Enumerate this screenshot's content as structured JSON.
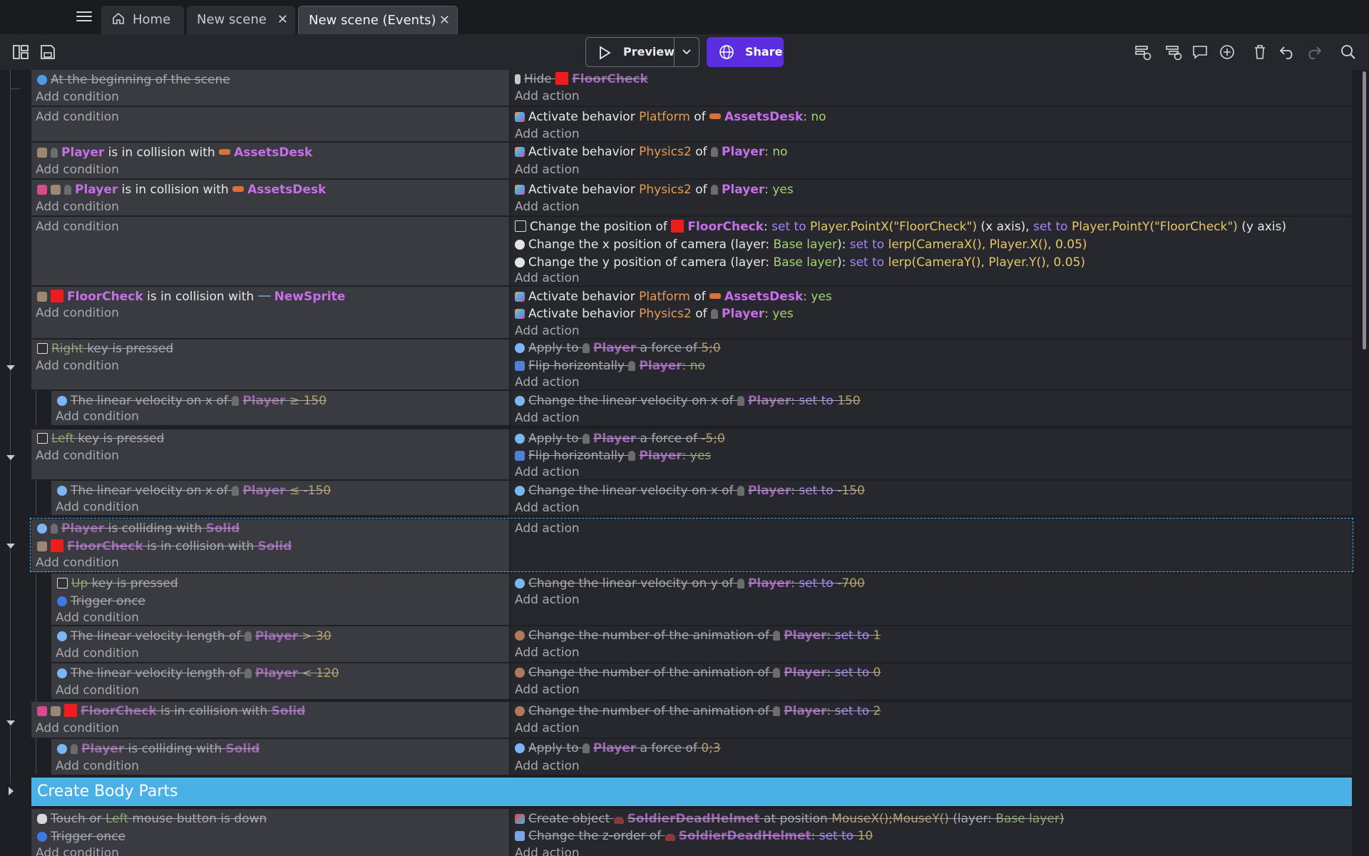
{
  "tabs": [
    {
      "label": "Home"
    },
    {
      "label": "New scene"
    },
    {
      "label": "New scene (Events)"
    }
  ],
  "toolbar": {
    "preview_label": "Preview",
    "share_label": "Share"
  },
  "common": {
    "add_condition": "Add condition",
    "add_action": "Add action",
    "of": "of",
    "colon_no": ": no",
    "colon_yes": ": yes",
    "set_to": "set to"
  },
  "events": {
    "e1": {
      "cond": "At the beginning of the scene",
      "act_hide": "Hide",
      "obj": "FloorCheck"
    },
    "e2": {
      "act_pre": "Activate behavior",
      "beh": "Platform",
      "obj": "AssetsDesk",
      "val": ": no"
    },
    "e3": {
      "obj1": "Player",
      "mid": "is in collision with",
      "obj2": "AssetsDesk",
      "act_pre": "Activate behavior",
      "beh": "Physics2",
      "aobj": "Player",
      "val": ": no"
    },
    "e4": {
      "obj1": "Player",
      "mid": "is in collision with",
      "obj2": "AssetsDesk",
      "act_pre": "Activate behavior",
      "beh": "Physics2",
      "aobj": "Player",
      "val": ": yes"
    },
    "e5": {
      "a1_pre": "Change the position of",
      "a1_obj": "FloorCheck",
      "a1_x": "Player.PointX(\"FloorCheck\")",
      "a1_xaxis": "(x axis),",
      "a1_y": "Player.PointY(\"FloorCheck\")",
      "a1_yaxis": "(y axis)",
      "a2_pre": "Change the x position of camera  (layer:",
      "a2_layer": "Base layer",
      "a2_mid": "):",
      "a2_val": "lerp(CameraX(), Player.X(), 0.05)",
      "a3_pre": "Change the y position of camera  (layer:",
      "a3_layer": "Base layer",
      "a3_mid": "):",
      "a3_val": "lerp(CameraY(), Player.Y(), 0.05)"
    },
    "e6": {
      "obj1": "FloorCheck",
      "mid": "is in collision with",
      "obj2": "NewSprite",
      "a1_pre": "Activate behavior",
      "a1_beh": "Platform",
      "a1_obj": "AssetsDesk",
      "a1_val": ": yes",
      "a2_pre": "Activate behavior",
      "a2_beh": "Physics2",
      "a2_obj": "Player",
      "a2_val": ": yes"
    },
    "e7": {
      "key": "Right",
      "cond_suffix": "key is pressed",
      "a1_pre": "Apply to",
      "a1_obj": "Player",
      "a1_mid": "a force of",
      "a1_val": "5;0",
      "a2_pre": "Flip horizontally",
      "a2_obj": "Player",
      "a2_val": ": no"
    },
    "e7s": {
      "cond_pre": "The linear velocity on x of",
      "obj": "Player",
      "cond_val": "≥ 150",
      "act_pre": "Change the linear velocity on x of",
      "act_obj": "Player",
      "act_colon": ":",
      "act_val": "150"
    },
    "e8": {
      "key": "Left",
      "cond_suffix": "key is pressed",
      "a1_pre": "Apply to",
      "a1_obj": "Player",
      "a1_mid": "a force of",
      "a1_val": "-5;0",
      "a2_pre": "Flip horizontally",
      "a2_obj": "Player",
      "a2_val": ": yes"
    },
    "e8s": {
      "cond_pre": "The linear velocity on x of",
      "obj": "Player",
      "cond_val": "≤ -150",
      "act_pre": "Change the linear velocity on x of",
      "act_obj": "Player",
      "act_colon": ":",
      "act_val": "-150"
    },
    "e9": {
      "c1_obj": "Player",
      "c1_mid": "is colliding with",
      "c1_obj2": "Solid",
      "c2_obj": "FloorCheck",
      "c2_mid": "is in collision with",
      "c2_obj2": "Solid"
    },
    "e9s1": {
      "key": "Up",
      "cond_suffix": "key is pressed",
      "c2": "Trigger once",
      "act_pre": "Change the linear velocity on y of",
      "act_obj": "Player",
      "act_colon": ":",
      "act_val": "-700"
    },
    "e9s2": {
      "cond_pre": "The linear velocity length of",
      "obj": "Player",
      "cond_val": "> 30",
      "act_pre": "Change the number of the animation of",
      "act_obj": "Player",
      "act_colon": ":",
      "act_val": "1"
    },
    "e9s3": {
      "cond_pre": "The linear velocity length of",
      "obj": "Player",
      "cond_val": "< 120",
      "act_pre": "Change the number of the animation of",
      "act_obj": "Player",
      "act_colon": ":",
      "act_val": "0"
    },
    "e10": {
      "obj1": "FloorCheck",
      "mid": "is in collision with",
      "obj2": "Solid",
      "act_pre": "Change the number of the animation of",
      "act_obj": "Player",
      "act_colon": ":",
      "act_val": "2"
    },
    "e10s": {
      "obj1": "Player",
      "mid": "is colliding with",
      "obj2": "Solid",
      "act_pre": "Apply to",
      "act_obj": "Player",
      "act_mid": "a force of",
      "act_val": "0;3"
    },
    "group": {
      "title": "Create Body Parts"
    },
    "e11": {
      "c1_pre": "Touch or",
      "c1_key": "Left",
      "c1_suffix": "mouse button is down",
      "c2": "Trigger once",
      "a1_pre": "Create object",
      "a1_obj": "SoldierDeadHelmet",
      "a1_mid": "at position",
      "a1_val": "MouseX();MouseY()",
      "a1_layer_pre": "(layer:",
      "a1_layer": "Base layer",
      "a1_layer_post": ")",
      "a2_pre": "Change the z-order of",
      "a2_obj": "SoldierDeadHelmet",
      "a2_colon": ":",
      "a2_val": "10"
    }
  }
}
